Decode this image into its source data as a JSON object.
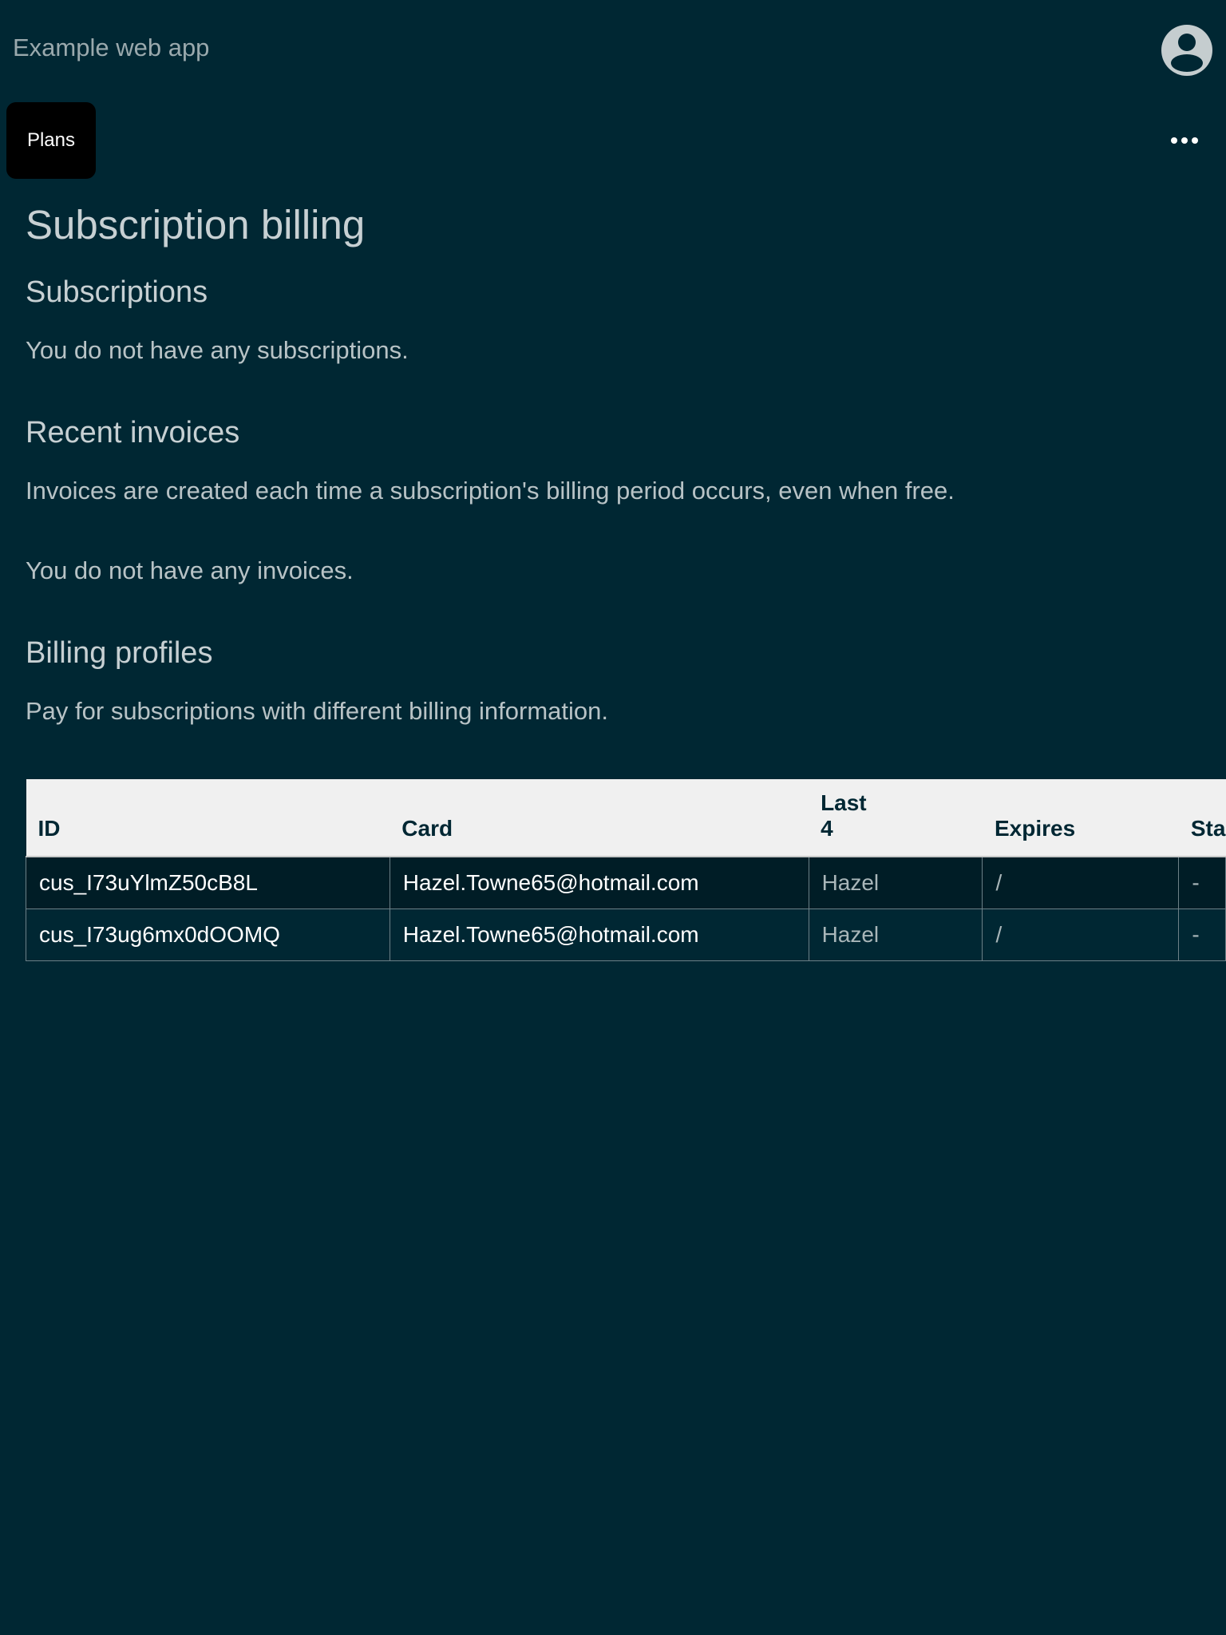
{
  "header": {
    "app_title": "Example web app",
    "avatar_icon": "user-avatar-icon"
  },
  "toolbar": {
    "plans_label": "Plans",
    "more_icon": "more-horizontal-icon"
  },
  "page": {
    "title": "Subscription billing",
    "subscriptions": {
      "heading": "Subscriptions",
      "empty_text": "You do not have any subscriptions."
    },
    "invoices": {
      "heading": "Recent invoices",
      "description": "Invoices are created each time a subscription's billing period occurs, even when free.",
      "empty_text": "You do not have any invoices."
    },
    "billing_profiles": {
      "heading": "Billing profiles",
      "description": "Pay for subscriptions with different billing information.",
      "columns": [
        "ID",
        "Card",
        "Last 4",
        "Expires",
        "Sta"
      ],
      "rows": [
        {
          "id": "cus_I73uYlmZ50cB8L",
          "card": "Hazel.Towne65@hotmail.com",
          "last4": "Hazel",
          "expires": "/",
          "status": "-"
        },
        {
          "id": "cus_I73ug6mx0dOOMQ",
          "card": "Hazel.Towne65@hotmail.com",
          "last4": "Hazel",
          "expires": "/",
          "status": "-"
        }
      ]
    }
  },
  "colors": {
    "background": "#002733",
    "table_header": "#f0f0f0",
    "button": "#000000"
  }
}
